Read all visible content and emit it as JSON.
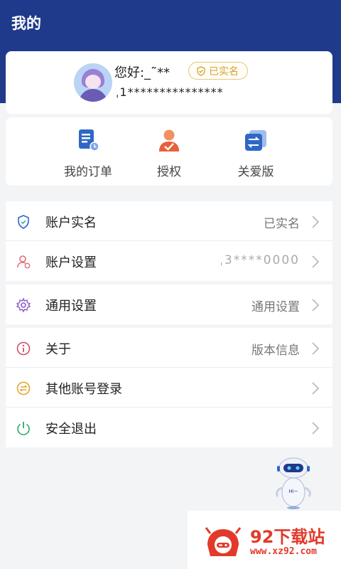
{
  "header": {
    "title": "我的"
  },
  "profile": {
    "greeting": "您好:_˜**",
    "verified_badge": "已实名",
    "phone": "ˌ1***************"
  },
  "quick_actions": [
    {
      "label": "我的订单",
      "icon": "order-icon"
    },
    {
      "label": "授权",
      "icon": "authorize-icon"
    },
    {
      "label": "关爱版",
      "icon": "care-mode-icon"
    }
  ],
  "menu": {
    "account_verify": {
      "label": "账户实名",
      "value": "已实名",
      "icon": "shield-icon"
    },
    "account_settings": {
      "label": "账户设置",
      "value": "ˌ3****0000",
      "icon": "user-settings-icon"
    },
    "general_settings": {
      "label": "通用设置",
      "value": "通用设置",
      "icon": "gear-icon"
    },
    "about": {
      "label": "关于",
      "value": "版本信息",
      "icon": "info-icon"
    },
    "other_login": {
      "label": "其他账号登录",
      "icon": "switch-account-icon"
    },
    "logout": {
      "label": "安全退出",
      "icon": "power-icon"
    }
  },
  "robot": {
    "label": "Hi~"
  },
  "watermark": {
    "title": "92下载站",
    "url": "www.xz92.com"
  },
  "colors": {
    "header_bg": "#1f3a8a",
    "badge_gold": "#d4a12e",
    "accent_blue": "#2f67c6",
    "accent_orange": "#e5623a"
  }
}
